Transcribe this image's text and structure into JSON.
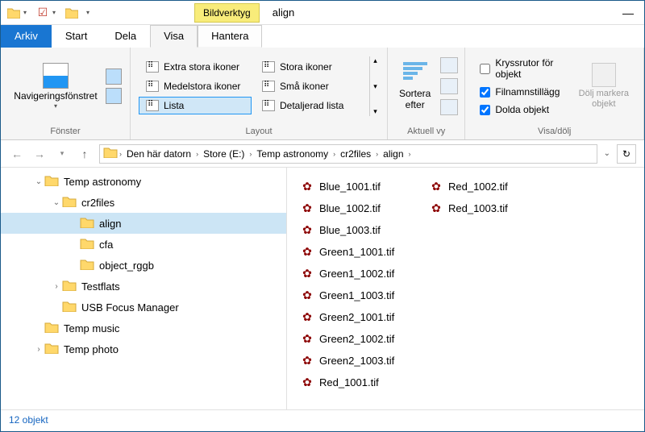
{
  "title_tools": "Bildverktyg",
  "title_text": "align",
  "menu": {
    "arkiv": "Arkiv",
    "start": "Start",
    "dela": "Dela",
    "visa": "Visa",
    "hantera": "Hantera"
  },
  "ribbon": {
    "nav_pane": "Navigeringsfönstret",
    "group_fonster": "Fönster",
    "layout_items": [
      [
        "Extra stora ikoner",
        "Stora ikoner"
      ],
      [
        "Medelstora ikoner",
        "Små ikoner"
      ],
      [
        "Lista",
        "Detaljerad lista"
      ]
    ],
    "layout_active": "Lista",
    "group_layout": "Layout",
    "sort": "Sortera\nefter",
    "group_current": "Aktuell vy",
    "checks": {
      "kryssrutor": "Kryssrutor för objekt",
      "filnamn": "Filnamnstillägg",
      "dolda": "Dolda objekt"
    },
    "hide_btn": "Dölj markera\nobjekt",
    "group_visa": "Visa/dölj"
  },
  "breadcrumb": [
    "Den här datorn",
    "Store (E:)",
    "Temp astronomy",
    "cr2files",
    "align"
  ],
  "tree": [
    {
      "indent": 1,
      "toggle": "v",
      "name": "Temp astronomy"
    },
    {
      "indent": 2,
      "toggle": "v",
      "name": "cr2files"
    },
    {
      "indent": 3,
      "toggle": "",
      "name": "align",
      "selected": true
    },
    {
      "indent": 3,
      "toggle": "",
      "name": "cfa"
    },
    {
      "indent": 3,
      "toggle": "",
      "name": "object_rggb"
    },
    {
      "indent": 2,
      "toggle": ">",
      "name": "Testflats"
    },
    {
      "indent": 2,
      "toggle": "",
      "name": "USB Focus Manager"
    },
    {
      "indent": 1,
      "toggle": "",
      "name": "Temp music"
    },
    {
      "indent": 1,
      "toggle": ">",
      "name": "Temp photo"
    }
  ],
  "files": [
    "Blue_1001.tif",
    "Blue_1002.tif",
    "Blue_1003.tif",
    "Green1_1001.tif",
    "Green1_1002.tif",
    "Green1_1003.tif",
    "Green2_1001.tif",
    "Green2_1002.tif",
    "Green2_1003.tif",
    "Red_1001.tif",
    "Red_1002.tif",
    "Red_1003.tif"
  ],
  "status": "12 objekt"
}
